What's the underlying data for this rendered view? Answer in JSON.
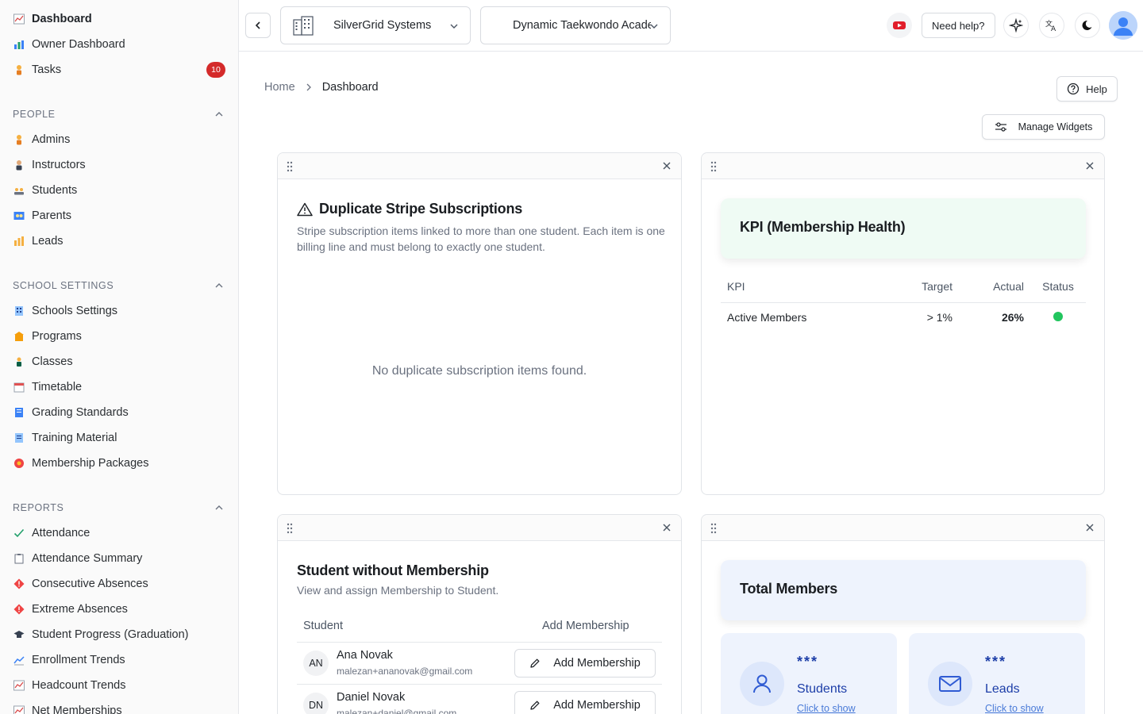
{
  "sidebar": {
    "top_items": [
      {
        "label": "Dashboard",
        "icon": "chart-emoji-icon"
      },
      {
        "label": "Owner Dashboard",
        "icon": "bar-chart-icon"
      },
      {
        "label": "Tasks",
        "icon": "person-icon",
        "badge": "10"
      }
    ],
    "sections": [
      {
        "title": "PEOPLE",
        "items": [
          {
            "label": "Admins",
            "icon": "admin-person-icon"
          },
          {
            "label": "Instructors",
            "icon": "instructor-icon"
          },
          {
            "label": "Students",
            "icon": "students-icon"
          },
          {
            "label": "Parents",
            "icon": "parents-icon"
          },
          {
            "label": "Leads",
            "icon": "leads-chart-icon"
          }
        ]
      },
      {
        "title": "SCHOOL SETTINGS",
        "items": [
          {
            "label": "Schools Settings",
            "icon": "building-icon"
          },
          {
            "label": "Programs",
            "icon": "programs-icon"
          },
          {
            "label": "Classes",
            "icon": "classes-icon"
          },
          {
            "label": "Timetable",
            "icon": "calendar-icon"
          },
          {
            "label": "Grading Standards",
            "icon": "book-icon"
          },
          {
            "label": "Training Material",
            "icon": "document-icon"
          },
          {
            "label": "Membership Packages",
            "icon": "membership-badge-icon"
          }
        ]
      },
      {
        "title": "REPORTS",
        "items": [
          {
            "label": "Attendance",
            "icon": "check-icon"
          },
          {
            "label": "Attendance Summary",
            "icon": "clipboard-icon"
          },
          {
            "label": "Consecutive Absences",
            "icon": "warning-diamond-icon"
          },
          {
            "label": "Extreme Absences",
            "icon": "warning-diamond-icon"
          },
          {
            "label": "Student Progress (Graduation)",
            "icon": "graduation-cap-icon"
          },
          {
            "label": "Enrollment Trends",
            "icon": "trend-chart-icon"
          },
          {
            "label": "Headcount Trends",
            "icon": "chart-emoji-icon"
          },
          {
            "label": "Net Memberships",
            "icon": "chart-emoji-icon"
          }
        ]
      }
    ]
  },
  "topbar": {
    "org_select": "SilverGrid Systems",
    "school_select": "Dynamic Taekwondo Acade",
    "need_help": "Need help?"
  },
  "breadcrumb": {
    "home": "Home",
    "current": "Dashboard"
  },
  "help_button": "Help",
  "manage_widgets": "Manage Widgets",
  "widgets": {
    "duplicates": {
      "title": "Duplicate Stripe Subscriptions",
      "subtitle": "Stripe subscription items linked to more than one student. Each item is one billing line and must belong to exactly one student.",
      "empty": "No duplicate subscription items found."
    },
    "kpi": {
      "title": "KPI (Membership Health)",
      "columns": [
        "KPI",
        "Target",
        "Actual",
        "Status"
      ],
      "rows": [
        {
          "kpi": "Active Members",
          "target": "> 1%",
          "actual": "26%",
          "status_color": "#22c55e"
        }
      ]
    },
    "students_without": {
      "title": "Student without Membership",
      "subtitle": "View and assign Membership to Student.",
      "columns": [
        "Student",
        "Add Membership"
      ],
      "rows": [
        {
          "initials": "AN",
          "name": "Ana Novak",
          "email": "malezan+ananovak@gmail.com",
          "action": "Add Membership"
        },
        {
          "initials": "DN",
          "name": "Daniel Novak",
          "email": "malezan+daniel@gmail.com",
          "action": "Add Membership"
        }
      ]
    },
    "total_members": {
      "title": "Total Members",
      "cards": [
        {
          "value": "***",
          "label": "Students",
          "link": "Click to show"
        },
        {
          "value": "***",
          "label": "Leads",
          "link": "Click to show"
        }
      ]
    }
  },
  "colors": {
    "badge": "#d42a2a",
    "kpi_card_bg": "#effbf4",
    "total_card_bg": "#eef3fd",
    "stat_text": "#1d3ea8"
  }
}
